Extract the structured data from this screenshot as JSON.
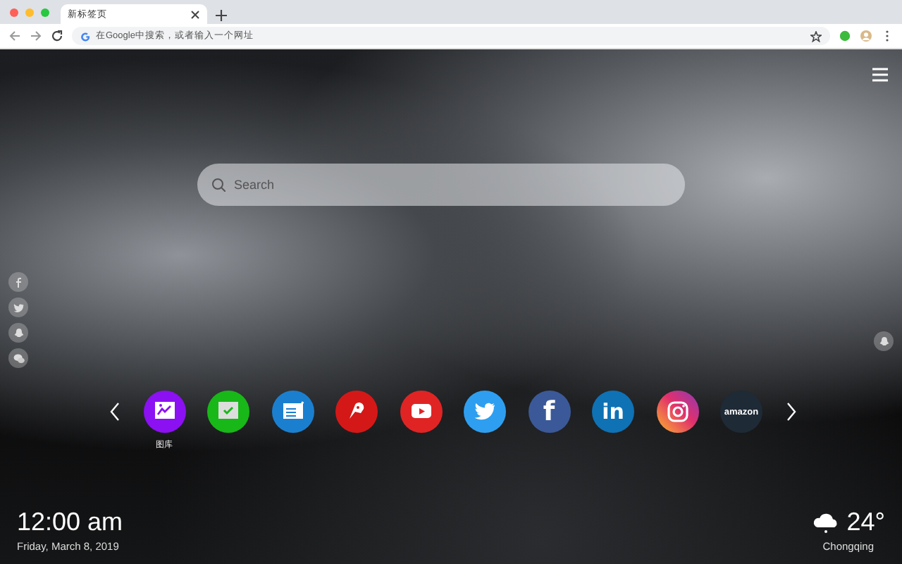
{
  "browser": {
    "window_controls": [
      {
        "color": "#fe5f57"
      },
      {
        "color": "#febc2e"
      },
      {
        "color": "#28c840"
      }
    ],
    "tabs": [
      {
        "title": "新标签页",
        "selected": true
      }
    ],
    "address_bar": {
      "placeholder": "在Google中搜索，或者输入一个网址"
    }
  },
  "page": {
    "search": {
      "placeholder": "Search"
    },
    "social_links": [
      {
        "kind": "facebook"
      },
      {
        "kind": "twitter"
      },
      {
        "kind": "ghost"
      },
      {
        "kind": "wechat"
      }
    ],
    "shortcuts": [
      {
        "kind": "gallery",
        "color": "#8b10f2",
        "label": "图库"
      },
      {
        "kind": "check",
        "color": "#18b818"
      },
      {
        "kind": "news",
        "color": "#1b7fd0"
      },
      {
        "kind": "game",
        "color": "#d41818"
      },
      {
        "kind": "video",
        "color": "#e02424"
      },
      {
        "kind": "bird",
        "color": "#2e9ff0"
      },
      {
        "kind": "letters",
        "color": "#3b5998",
        "glyph": "f"
      },
      {
        "kind": "letters",
        "color": "#0e72b5",
        "glyph": "in"
      },
      {
        "kind": "camera",
        "color": "#e1306c"
      },
      {
        "kind": "letters",
        "color": "#1e2a36",
        "glyph": "amazon"
      }
    ],
    "clock": {
      "time": "12:00 am",
      "date": "Friday, March 8, 2019"
    },
    "weather": {
      "temperature": "24°",
      "city": "Chongqing"
    }
  }
}
